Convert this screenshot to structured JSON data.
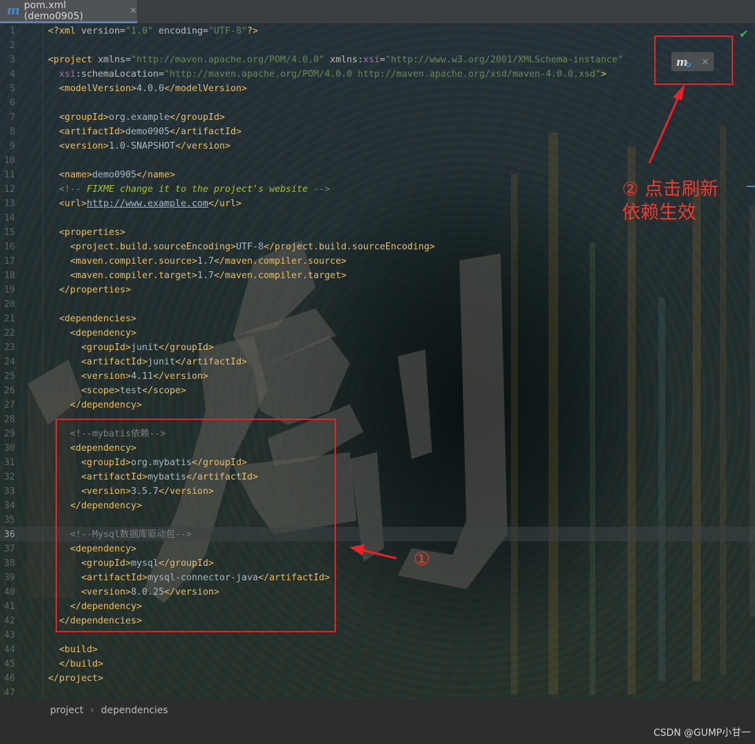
{
  "tab": {
    "icon": "maven-m-icon",
    "label": "pom.xml (demo0905)",
    "close": "×"
  },
  "lines": [
    {
      "n": "1",
      "cur": false,
      "segs": [
        {
          "c": "t",
          "x": "<?xml "
        },
        {
          "c": "a",
          "x": "version="
        },
        {
          "c": "v",
          "x": "\"1.0\""
        },
        {
          "c": "a",
          "x": " encoding="
        },
        {
          "c": "v",
          "x": "\"UTF-8\""
        },
        {
          "c": "t",
          "x": "?>"
        }
      ]
    },
    {
      "n": "2",
      "cur": false,
      "segs": []
    },
    {
      "n": "3",
      "cur": false,
      "segs": [
        {
          "c": "t",
          "x": "<project "
        },
        {
          "c": "a",
          "x": "xmlns="
        },
        {
          "c": "v",
          "x": "\"http://maven.apache.org/POM/4.0.0\""
        },
        {
          "c": "a",
          "x": " xmlns:"
        },
        {
          "c": "ns",
          "x": "xsi"
        },
        {
          "c": "a",
          "x": "="
        },
        {
          "c": "v",
          "x": "\"http://www.w3.org/2001/XMLSchema-instance\""
        }
      ]
    },
    {
      "n": "4",
      "cur": false,
      "segs": [
        {
          "c": "p",
          "x": "  "
        },
        {
          "c": "ns",
          "x": "xsi"
        },
        {
          "c": "a",
          "x": ":schemaLocation="
        },
        {
          "c": "v",
          "x": "\"http://maven.apache.org/POM/4.0.0 http://maven.apache.org/xsd/maven-4.0.0.xsd\""
        },
        {
          "c": "t",
          "x": ">"
        }
      ]
    },
    {
      "n": "5",
      "cur": false,
      "segs": [
        {
          "c": "p",
          "x": "  "
        },
        {
          "c": "t",
          "x": "<modelVersion>"
        },
        {
          "c": "p",
          "x": "4.0.0"
        },
        {
          "c": "t",
          "x": "</modelVersion>"
        }
      ]
    },
    {
      "n": "6",
      "cur": false,
      "segs": []
    },
    {
      "n": "7",
      "cur": false,
      "segs": [
        {
          "c": "p",
          "x": "  "
        },
        {
          "c": "t",
          "x": "<groupId>"
        },
        {
          "c": "p",
          "x": "org.example"
        },
        {
          "c": "t",
          "x": "</groupId>"
        }
      ]
    },
    {
      "n": "8",
      "cur": false,
      "segs": [
        {
          "c": "p",
          "x": "  "
        },
        {
          "c": "t",
          "x": "<artifactId>"
        },
        {
          "c": "p",
          "x": "demo0905"
        },
        {
          "c": "t",
          "x": "</artifactId>"
        }
      ]
    },
    {
      "n": "9",
      "cur": false,
      "segs": [
        {
          "c": "p",
          "x": "  "
        },
        {
          "c": "t",
          "x": "<version>"
        },
        {
          "c": "p",
          "x": "1.0-SNAPSHOT"
        },
        {
          "c": "t",
          "x": "</version>"
        }
      ]
    },
    {
      "n": "10",
      "cur": false,
      "segs": []
    },
    {
      "n": "11",
      "cur": false,
      "segs": [
        {
          "c": "p",
          "x": "  "
        },
        {
          "c": "t",
          "x": "<name>"
        },
        {
          "c": "p",
          "x": "demo0905"
        },
        {
          "c": "t",
          "x": "</name>"
        }
      ]
    },
    {
      "n": "12",
      "cur": false,
      "segs": [
        {
          "c": "p",
          "x": "  "
        },
        {
          "c": "c",
          "x": "<!-- "
        },
        {
          "c": "fix",
          "x": "FIXME change it to the project's website"
        },
        {
          "c": "c",
          "x": " -->"
        }
      ]
    },
    {
      "n": "13",
      "cur": false,
      "segs": [
        {
          "c": "p",
          "x": "  "
        },
        {
          "c": "t",
          "x": "<url>"
        },
        {
          "c": "pu",
          "x": "http://www.example.com"
        },
        {
          "c": "t",
          "x": "</url>"
        }
      ]
    },
    {
      "n": "14",
      "cur": false,
      "segs": []
    },
    {
      "n": "15",
      "cur": false,
      "segs": [
        {
          "c": "p",
          "x": "  "
        },
        {
          "c": "t",
          "x": "<properties>"
        }
      ]
    },
    {
      "n": "16",
      "cur": false,
      "segs": [
        {
          "c": "p",
          "x": "    "
        },
        {
          "c": "t",
          "x": "<project.build.sourceEncoding>"
        },
        {
          "c": "p",
          "x": "UTF-8"
        },
        {
          "c": "t",
          "x": "</project.build.sourceEncoding>"
        }
      ]
    },
    {
      "n": "17",
      "cur": false,
      "segs": [
        {
          "c": "p",
          "x": "    "
        },
        {
          "c": "t",
          "x": "<maven.compiler.source>"
        },
        {
          "c": "p",
          "x": "1.7"
        },
        {
          "c": "t",
          "x": "</maven.compiler.source>"
        }
      ]
    },
    {
      "n": "18",
      "cur": false,
      "segs": [
        {
          "c": "p",
          "x": "    "
        },
        {
          "c": "t",
          "x": "<maven.compiler.target>"
        },
        {
          "c": "p",
          "x": "1.7"
        },
        {
          "c": "t",
          "x": "</maven.compiler.target>"
        }
      ]
    },
    {
      "n": "19",
      "cur": false,
      "segs": [
        {
          "c": "p",
          "x": "  "
        },
        {
          "c": "t",
          "x": "</properties>"
        }
      ]
    },
    {
      "n": "20",
      "cur": false,
      "segs": []
    },
    {
      "n": "21",
      "cur": false,
      "segs": [
        {
          "c": "p",
          "x": "  "
        },
        {
          "c": "t",
          "x": "<dependencies>"
        }
      ]
    },
    {
      "n": "22",
      "cur": false,
      "segs": [
        {
          "c": "p",
          "x": "    "
        },
        {
          "c": "t",
          "x": "<dependency>"
        }
      ]
    },
    {
      "n": "23",
      "cur": false,
      "segs": [
        {
          "c": "p",
          "x": "      "
        },
        {
          "c": "t",
          "x": "<groupId>"
        },
        {
          "c": "p",
          "x": "junit"
        },
        {
          "c": "t",
          "x": "</groupId>"
        }
      ]
    },
    {
      "n": "24",
      "cur": false,
      "segs": [
        {
          "c": "p",
          "x": "      "
        },
        {
          "c": "t",
          "x": "<artifactId>"
        },
        {
          "c": "p",
          "x": "junit"
        },
        {
          "c": "t",
          "x": "</artifactId>"
        }
      ]
    },
    {
      "n": "25",
      "cur": false,
      "segs": [
        {
          "c": "p",
          "x": "      "
        },
        {
          "c": "t",
          "x": "<version>"
        },
        {
          "c": "p",
          "x": "4.11"
        },
        {
          "c": "t",
          "x": "</version>"
        }
      ]
    },
    {
      "n": "26",
      "cur": false,
      "segs": [
        {
          "c": "p",
          "x": "      "
        },
        {
          "c": "t",
          "x": "<scope>"
        },
        {
          "c": "p",
          "x": "test"
        },
        {
          "c": "t",
          "x": "</scope>"
        }
      ]
    },
    {
      "n": "27",
      "cur": false,
      "segs": [
        {
          "c": "p",
          "x": "    "
        },
        {
          "c": "t",
          "x": "</dependency>"
        }
      ]
    },
    {
      "n": "28",
      "cur": false,
      "segs": []
    },
    {
      "n": "29",
      "cur": false,
      "segs": [
        {
          "c": "p",
          "x": "    "
        },
        {
          "c": "c",
          "x": "<!--mybatis依赖-->"
        }
      ]
    },
    {
      "n": "30",
      "cur": false,
      "segs": [
        {
          "c": "p",
          "x": "    "
        },
        {
          "c": "t",
          "x": "<dependency>"
        }
      ]
    },
    {
      "n": "31",
      "cur": false,
      "segs": [
        {
          "c": "p",
          "x": "      "
        },
        {
          "c": "t",
          "x": "<groupId>"
        },
        {
          "c": "p",
          "x": "org.mybatis"
        },
        {
          "c": "t",
          "x": "</groupId>"
        }
      ]
    },
    {
      "n": "32",
      "cur": false,
      "segs": [
        {
          "c": "p",
          "x": "      "
        },
        {
          "c": "t",
          "x": "<artifactId>"
        },
        {
          "c": "p",
          "x": "mybatis"
        },
        {
          "c": "t",
          "x": "</artifactId>"
        }
      ]
    },
    {
      "n": "33",
      "cur": false,
      "segs": [
        {
          "c": "p",
          "x": "      "
        },
        {
          "c": "t",
          "x": "<version>"
        },
        {
          "c": "p",
          "x": "3.5.7"
        },
        {
          "c": "t",
          "x": "</version>"
        }
      ]
    },
    {
      "n": "34",
      "cur": false,
      "segs": [
        {
          "c": "p",
          "x": "    "
        },
        {
          "c": "t",
          "x": "</dependency>"
        }
      ]
    },
    {
      "n": "35",
      "cur": false,
      "segs": []
    },
    {
      "n": "36",
      "cur": true,
      "segs": [
        {
          "c": "p",
          "x": "    "
        },
        {
          "c": "c",
          "x": "<!--Mysql数据库驱动包-->"
        }
      ]
    },
    {
      "n": "37",
      "cur": false,
      "segs": [
        {
          "c": "p",
          "x": "    "
        },
        {
          "c": "t",
          "x": "<dependency>"
        }
      ]
    },
    {
      "n": "38",
      "cur": false,
      "segs": [
        {
          "c": "p",
          "x": "      "
        },
        {
          "c": "t",
          "x": "<groupId>"
        },
        {
          "c": "p",
          "x": "mysql"
        },
        {
          "c": "t",
          "x": "</groupId>"
        }
      ]
    },
    {
      "n": "39",
      "cur": false,
      "segs": [
        {
          "c": "p",
          "x": "      "
        },
        {
          "c": "t",
          "x": "<artifactId>"
        },
        {
          "c": "p",
          "x": "mysql-connector-java"
        },
        {
          "c": "t",
          "x": "</artifactId>"
        }
      ]
    },
    {
      "n": "40",
      "cur": false,
      "segs": [
        {
          "c": "p",
          "x": "      "
        },
        {
          "c": "t",
          "x": "<version>"
        },
        {
          "c": "p",
          "x": "8.0.25"
        },
        {
          "c": "t",
          "x": "</version>"
        }
      ]
    },
    {
      "n": "41",
      "cur": false,
      "segs": [
        {
          "c": "p",
          "x": "    "
        },
        {
          "c": "t",
          "x": "</dependency>"
        }
      ]
    },
    {
      "n": "42",
      "cur": false,
      "segs": [
        {
          "c": "p",
          "x": "  "
        },
        {
          "c": "t",
          "x": "</dependencies>"
        }
      ]
    },
    {
      "n": "43",
      "cur": false,
      "segs": []
    },
    {
      "n": "44",
      "cur": false,
      "segs": [
        {
          "c": "p",
          "x": "  "
        },
        {
          "c": "t",
          "x": "<build>"
        }
      ]
    },
    {
      "n": "45",
      "cur": false,
      "segs": [
        {
          "c": "p",
          "x": "  "
        },
        {
          "c": "t",
          "x": "</build>"
        }
      ]
    },
    {
      "n": "46",
      "cur": false,
      "segs": [
        {
          "c": "t",
          "x": "</project>"
        }
      ]
    },
    {
      "n": "47",
      "cur": false,
      "segs": []
    }
  ],
  "maven_reload": {
    "icon": "maven-reload-icon",
    "m": "m",
    "close": "×"
  },
  "status_icon": "checkmark-icon",
  "annotations": {
    "refresh_note": "② 点击刷新\n依赖生效",
    "marker_1": "①"
  },
  "breadcrumb": {
    "items": [
      "project",
      "dependencies"
    ],
    "separator": "›"
  },
  "watermark": "CSDN @GUMP小甘一",
  "colors": {
    "tag": "#e8bf6a",
    "attr_value": "#6a8759",
    "comment": "#808080",
    "annotation_red": "#e8242b",
    "accent": "#4a88c7"
  }
}
